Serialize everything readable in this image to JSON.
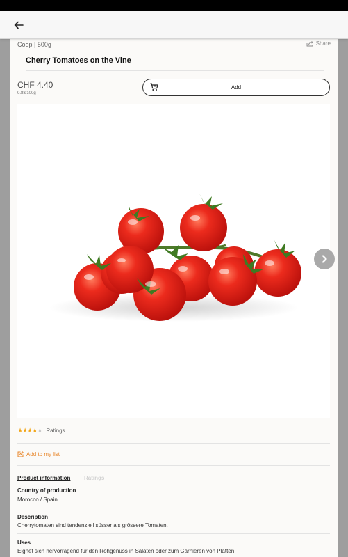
{
  "app_bar": {
    "back_icon": "arrow-left-icon"
  },
  "product": {
    "brand_size": "Coop  |  500g",
    "share_label": "Share",
    "title": "Cherry Tomatoes on the Vine",
    "price": "CHF 4.40",
    "unit_price": "0.88/100g",
    "add_label": "Add",
    "rating_stars": 4,
    "rating_max": 5,
    "ratings_label": "Ratings",
    "add_to_list_label": "Add to my list"
  },
  "tabs": [
    {
      "label": "Product information",
      "active": true
    },
    {
      "label": "Ratings",
      "active": false
    }
  ],
  "details": [
    {
      "title": "Country of production",
      "text": "Morocco / Spain"
    },
    {
      "title": "Description",
      "text": "Cherrytomaten sind tendenziell süsser als grössere Tomaten."
    },
    {
      "title": "Uses",
      "text": "Eignet sich hervorragend für den Rohgenuss in Salaten oder zum Garnieren von Platten."
    }
  ],
  "colors": {
    "accent_orange": "#e8862a",
    "star": "#f2a516",
    "tomato_red": "#e0201a"
  }
}
